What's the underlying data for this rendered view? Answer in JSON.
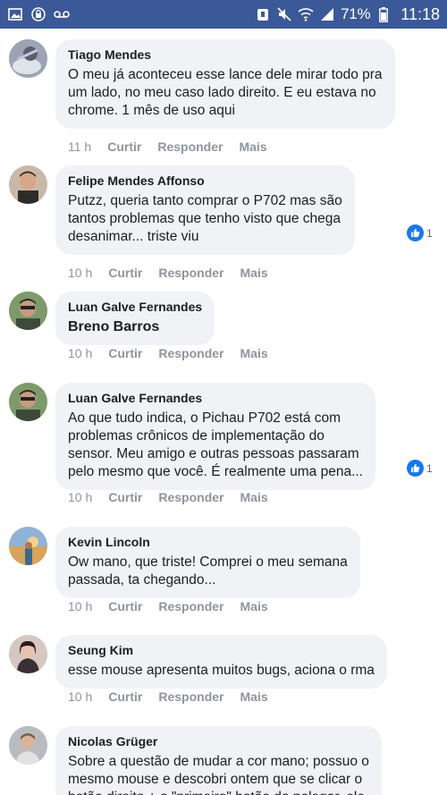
{
  "statusbar": {
    "battery": "71%",
    "time": "11:18",
    "left_icons": [
      "image-icon",
      "lock-icon",
      "voicemail-icon"
    ],
    "right_icons": [
      "alarm-icon",
      "mute-icon",
      "wifi-icon",
      "signal-icon",
      "battery-icon"
    ]
  },
  "actions": {
    "like": "Curtir",
    "reply": "Responder",
    "more": "Mais"
  },
  "comments": [
    {
      "author": "Tiago Mendes",
      "text": "O meu já aconteceu esse lance dele mirar todo pra\num lado, no meu caso lado direito. E eu estava no\nchrome. 1 mês de uso aqui",
      "time": "11 h"
    },
    {
      "author": "Felipe Mendes Affonso",
      "text": "Putzz, queria tanto comprar o P702 mas são\ntantos problemas que tenho visto que chega\ndesanimar... triste viu",
      "time": "10 h",
      "reactions": "1"
    },
    {
      "author": "Luan Galve Fernandes",
      "text": "Breno Barros",
      "time": "10 h"
    },
    {
      "author": "Luan Galve Fernandes",
      "text": "Ao que tudo indica, o Pichau P702 está com\nproblemas crônicos de implementação do\nsensor. Meu amigo e outras pessoas passaram\npelo mesmo que você. É realmente uma pena...",
      "time": "10 h",
      "reactions": "1"
    },
    {
      "author": "Kevin Lincoln",
      "text": "Ow mano, que triste! Comprei o meu semana\npassada, ta chegando...",
      "time": "10 h"
    },
    {
      "author": "Seung Kim",
      "text": "esse mouse apresenta muitos bugs, aciona o rma",
      "time": "10 h"
    },
    {
      "author": "Nicolas Grüger",
      "text": "Sobre a questão de mudar a cor mano; possuo o\nmesmo mouse e descobri ontem que se clicar o\nbotão direito + o \"primeiro\" botão do polegar, ele"
    }
  ]
}
